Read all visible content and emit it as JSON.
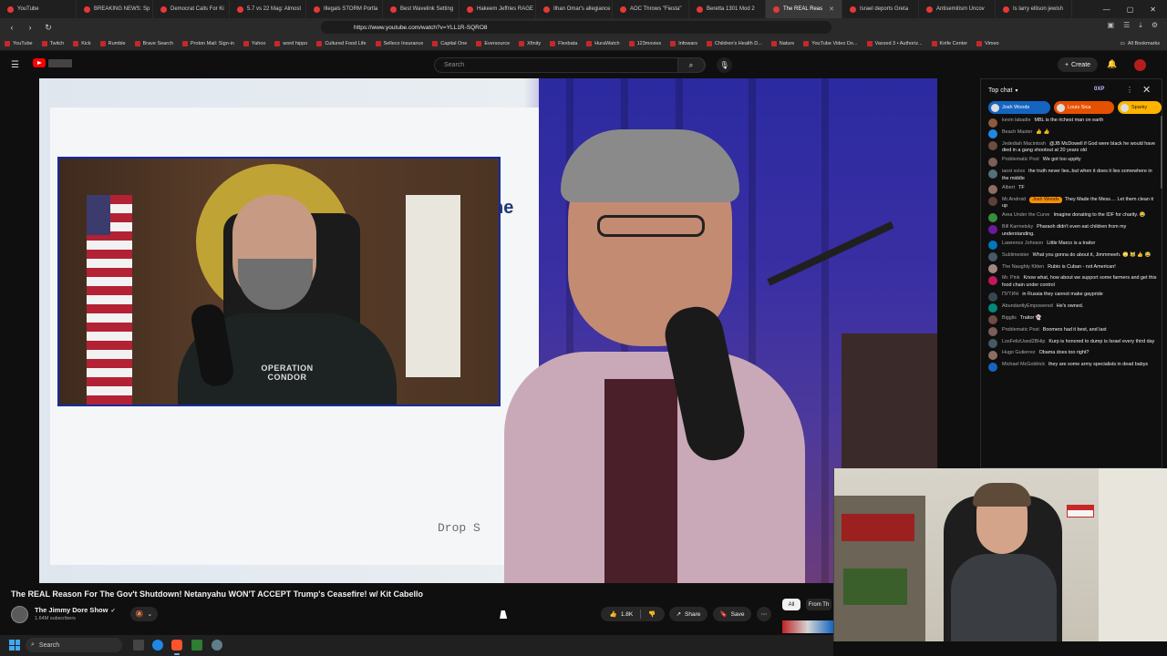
{
  "browser": {
    "tabs": [
      {
        "label": "YouTube",
        "active": false
      },
      {
        "label": "BREAKING NEWS: Sp",
        "active": false
      },
      {
        "label": "Democrat Calls For Ki",
        "active": false
      },
      {
        "label": "5.7 vs 22 Mag: Almost",
        "active": false
      },
      {
        "label": "Illegals STORM Portla",
        "active": false
      },
      {
        "label": "Best Wavelink Setting",
        "active": false
      },
      {
        "label": "Hakeem Jeffries RAGE",
        "active": false
      },
      {
        "label": "Ilhan Omar's allegiance",
        "active": false
      },
      {
        "label": "AOC Throws \"Fiesta\"",
        "active": false
      },
      {
        "label": "Beretta 1301 Mod 2",
        "active": false
      },
      {
        "label": "The REAL Reas",
        "active": true
      },
      {
        "label": "Israel deports Greta",
        "active": false
      },
      {
        "label": "Antisemitism Uncov",
        "active": false
      },
      {
        "label": "Is larry ellison jewish",
        "active": false
      }
    ],
    "url": "https://www.youtube.com/watch?v=YLL1R-SQRO8",
    "bookmarks": [
      "YouTube",
      "Twitch",
      "Kick",
      "Rumble",
      "Brave Search",
      "Proton Mail: Sign-in",
      "Yahoo",
      "word hippo",
      "Cultured Food Life",
      "Selleco Insurance",
      "Capital One",
      "Eversource",
      "Xfinity",
      "Flexbata",
      "HuraWatch",
      "123movies",
      "Infowars",
      "Children's Health D...",
      "Nature",
      "YouTube Video Do...",
      "Vaxxed 3 • Authoriz...",
      "Knife Center",
      "Vimeo"
    ],
    "all_bookmarks": "All Bookmarks"
  },
  "youtube": {
    "search_placeholder": "Search",
    "create_label": "Create"
  },
  "video": {
    "slide_fragment": "ne",
    "drop_text": "Drop S",
    "guest_shirt": "OPERATION CONDOR",
    "title": "The REAL Reason For The Gov't Shutdown! Netanyahu WON'T ACCEPT Trump's Ceasefire! w/ Kit Cabello",
    "channel": "The Jimmy Dore Show",
    "subscribers": "1.64M subscribers",
    "likes": "1.8K",
    "share_label": "Share",
    "save_label": "Save",
    "chips": {
      "all": "All",
      "from": "From Th"
    }
  },
  "chat": {
    "header": "Top chat",
    "xp": "0XP",
    "tickers": [
      "Josh Woods",
      "Louis Sica",
      "Sparky"
    ],
    "messages": [
      {
        "author": "kevin labadie",
        "text": "MBL is the richest man on earth",
        "color": "#8e5a3c"
      },
      {
        "author": "Beach Master",
        "text": "👍 👍",
        "color": "#1e88e5"
      },
      {
        "author": "Jedediah Macintosh",
        "text": "@JB McDowell if God were black he would have died in a gang shootout at 20 years old",
        "color": "#6d4c41"
      },
      {
        "author": "Problematic Post",
        "text": "We got too uppity",
        "color": "#7b5e57"
      },
      {
        "author": "iaoxi xoiox",
        "text": "the truth never lies..but when it does it lies somewhere in the middle",
        "color": "#546e7a"
      },
      {
        "author": "Albert",
        "text": "TF",
        "color": "#8d6e63"
      },
      {
        "author": "Mr.Android",
        "badge": "Josh Woods",
        "text": "They Made the Mess.... Let them clean it up",
        "color": "#5d4037"
      },
      {
        "author": "Area Under the Curve",
        "text": "Imagine donating to the IDF for charity. 😂",
        "color": "#388e3c"
      },
      {
        "author": "Bill Karmetsky",
        "text": "Pharaoh didn't even eat children from my understanding.",
        "color": "#6a1b9a"
      },
      {
        "author": "Lawrence Johnson",
        "text": "Little Marco is a traitor",
        "color": "#0277bd"
      },
      {
        "author": "Sublimeister",
        "text": "What you gonna do about it, Jimmmeeh. 🙄 😹 👍 😂",
        "color": "#455a64"
      },
      {
        "author": "The Naughty Kitten",
        "text": "Rubio is Cuban - not American!",
        "color": "#a1887f"
      },
      {
        "author": "Mr. Pink",
        "text": "Know what, how about we support some farmers and get this food chain under control",
        "color": "#c2185b"
      },
      {
        "author": "ПУТИН",
        "text": "in Russia they cannot make gaypride",
        "color": "#37474f"
      },
      {
        "author": "AbundantlyEmpowered",
        "text": "He's owned.",
        "color": "#00897b"
      },
      {
        "author": "Bigglis",
        "text": "Traitor 👻",
        "color": "#6d4c41"
      },
      {
        "author": "Problematic Post",
        "text": "Boomers had it best, and last",
        "color": "#7b5e57"
      },
      {
        "author": "LosFelizUsed2BHip",
        "text": "Kurp is honored to dump is Israel every third day",
        "color": "#455a64"
      },
      {
        "author": "Hugo Gutierrez",
        "text": "Obama does too right?",
        "color": "#8d6e63"
      },
      {
        "author": "Michael McGoldrick",
        "text": "they are some army specialists in dead babys",
        "color": "#1565c0"
      }
    ]
  },
  "taskbar": {
    "search_label": "Search"
  }
}
